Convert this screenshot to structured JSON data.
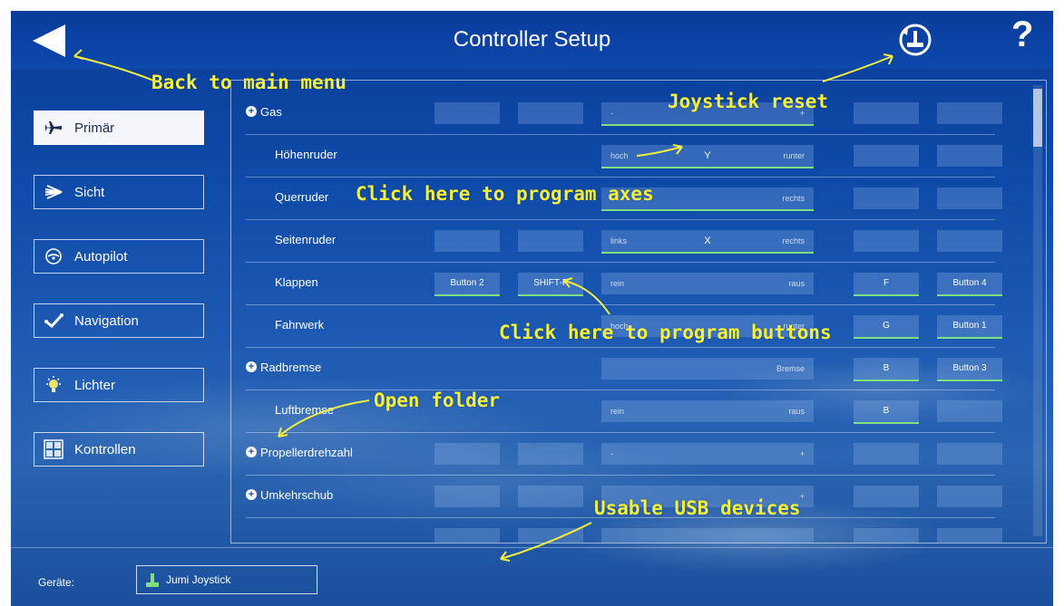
{
  "header": {
    "title": "Controller Setup",
    "back_icon": "back-arrow-icon",
    "reset_icon": "joystick-reset-icon",
    "help_label": "?"
  },
  "sidebar": {
    "items": [
      {
        "label": "Primär",
        "icon": "airplane-icon",
        "active": true
      },
      {
        "label": "Sicht",
        "icon": "view-icon",
        "active": false
      },
      {
        "label": "Autopilot",
        "icon": "autopilot-icon",
        "active": false
      },
      {
        "label": "Navigation",
        "icon": "navigation-icon",
        "active": false
      },
      {
        "label": "Lichter",
        "icon": "light-icon",
        "active": false
      },
      {
        "label": "Kontrollen",
        "icon": "controls-icon",
        "active": false
      }
    ]
  },
  "grid": {
    "rows": [
      {
        "label": "Gas",
        "folder": true,
        "axis": {
          "left": "-",
          "center": "",
          "right": "+"
        }
      },
      {
        "label": "Höhenruder",
        "folder": false,
        "axis": {
          "left": "hoch",
          "center": "Y",
          "right": "runter"
        }
      },
      {
        "label": "Querruder",
        "folder": false,
        "axis": {
          "left": "",
          "center": "",
          "right": "rechts"
        }
      },
      {
        "label": "Seitenruder",
        "folder": false,
        "axis": {
          "left": "links",
          "center": "X",
          "right": "rechts"
        }
      },
      {
        "label": "Klappen",
        "folder": false,
        "buttons": [
          "Button 2",
          "SHIFT-F"
        ],
        "axis": {
          "left": "rein",
          "center": "",
          "right": "raus"
        },
        "extra": [
          "F",
          "Button 4"
        ]
      },
      {
        "label": "Fahrwerk",
        "folder": false,
        "axis": {
          "left": "hoch",
          "center": "",
          "right": "runter"
        },
        "extra": [
          "G",
          "Button 1"
        ]
      },
      {
        "label": "Radbremse",
        "folder": true,
        "axis": {
          "left": "",
          "center": "",
          "right": "Bremse"
        },
        "extra": [
          "B",
          "Button 3"
        ]
      },
      {
        "label": "Luftbremse",
        "folder": false,
        "axis": {
          "left": "rein",
          "center": "",
          "right": "raus"
        },
        "extra": [
          "B",
          ""
        ]
      },
      {
        "label": "Propellerdrehzahl",
        "folder": true,
        "axis": {
          "left": "-",
          "center": "",
          "right": "+"
        }
      },
      {
        "label": "Umkehrschub",
        "folder": true,
        "axis": {
          "left": "",
          "center": "",
          "right": "+"
        }
      }
    ]
  },
  "footer": {
    "devices_label": "Geräte:",
    "device_name": "Jumi Joystick",
    "device_icon": "joystick-icon"
  },
  "annotations": {
    "back": "Back to main menu",
    "reset": "Joystick reset",
    "axes": "Click here to program axes",
    "buttons": "Click here to program buttons",
    "folder": "Open folder",
    "usb": "Usable USB devices"
  },
  "colors": {
    "annotation": "#f4ef3c",
    "assigned": "#7fe07f",
    "background": "#0e4aa8"
  }
}
